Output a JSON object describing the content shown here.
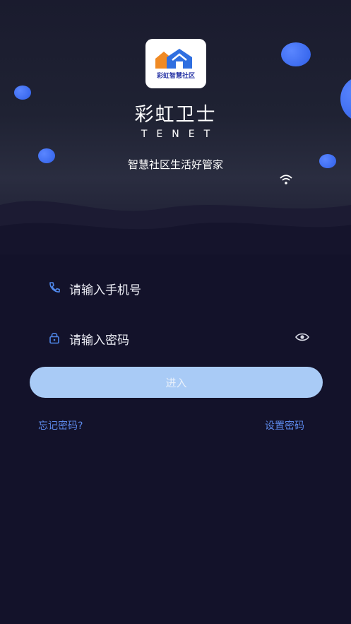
{
  "brand": {
    "logo_text": "彩虹智慧社区",
    "app_name": "彩虹卫士",
    "app_sub": "TENET",
    "slogan": "智慧社区生活好管家"
  },
  "login": {
    "phone_placeholder": "请输入手机号",
    "password_placeholder": "请输入密码",
    "enter_label": "进入",
    "forgot_label": "忘记密码?",
    "set_password_label": "设置密码"
  },
  "icons": {
    "phone": "phone-icon",
    "lock": "lock-icon",
    "eye": "eye-icon",
    "wifi": "wifi-icon"
  },
  "colors": {
    "background": "#13122a",
    "accent": "#2f5fe8",
    "button": "#a9cbf6",
    "link": "#5d89ea"
  }
}
